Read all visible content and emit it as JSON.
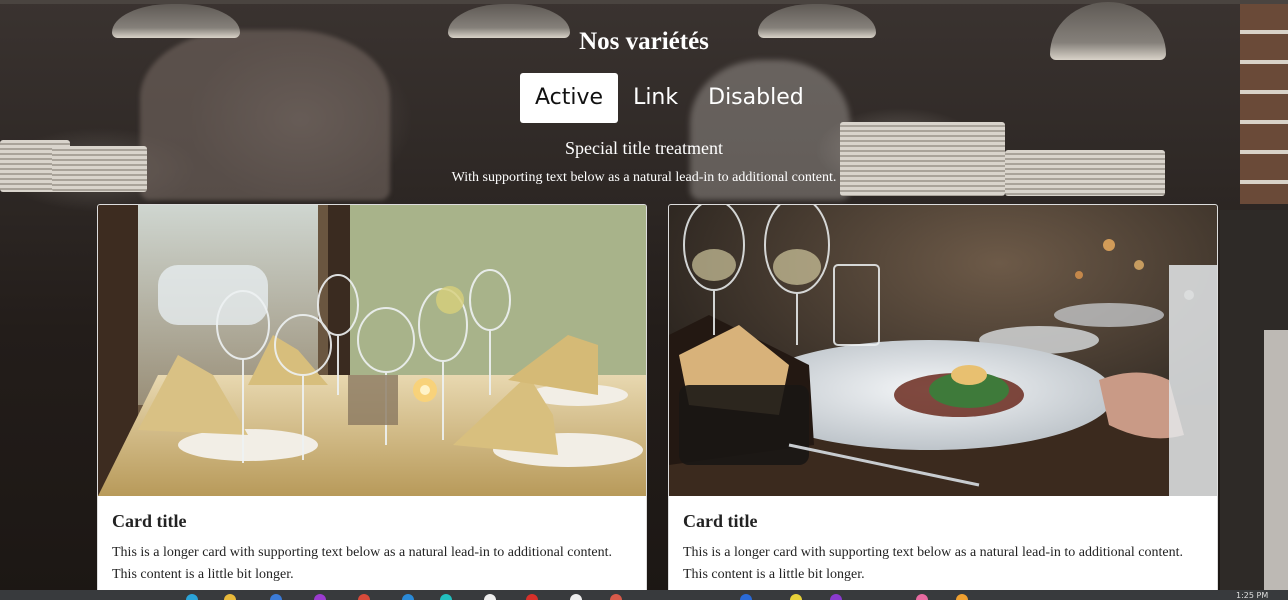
{
  "page": {
    "heading": "Nos variétés",
    "subtitle": "Special title treatment",
    "lead": "With supporting text below as a natural lead-in to additional content."
  },
  "nav": {
    "tabs": [
      {
        "label": "Active",
        "state": "active"
      },
      {
        "label": "Link",
        "state": "normal"
      },
      {
        "label": "Disabled",
        "state": "disabled"
      }
    ]
  },
  "cards": [
    {
      "image": "restaurant-table-setting-photo",
      "title": "Card title",
      "text": "This is a longer card with supporting text below as a natural lead-in to additional content. This content is a little bit longer."
    },
    {
      "image": "plated-dish-with-wine-photo",
      "title": "Card title",
      "text": "This is a longer card with supporting text below as a natural lead-in to additional content. This content is a little bit longer."
    }
  ],
  "taskbar": {
    "clock": "1:25 PM"
  },
  "colors": {
    "text_on_dark": "#ffffff",
    "active_tab_bg": "#ffffff",
    "card_bg": "#ffffff",
    "taskbar": "#383a3d"
  }
}
